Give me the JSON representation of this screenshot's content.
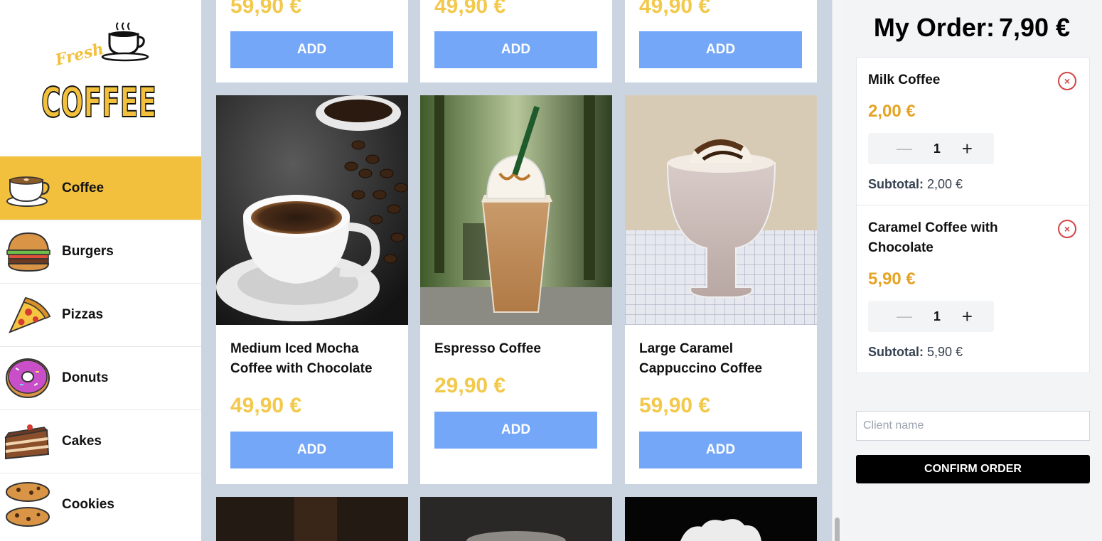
{
  "logo": {
    "top": "Fresh",
    "main": "COFFEE"
  },
  "categories": [
    {
      "label": "Coffee",
      "icon": "coffee-cup-icon",
      "active": true
    },
    {
      "label": "Burgers",
      "icon": "burger-icon"
    },
    {
      "label": "Pizzas",
      "icon": "pizza-slice-icon"
    },
    {
      "label": "Donuts",
      "icon": "donut-icon"
    },
    {
      "label": "Cakes",
      "icon": "cake-slice-icon"
    },
    {
      "label": "Cookies",
      "icon": "cookies-icon"
    }
  ],
  "products_top_row": [
    {
      "price": "59,90 €",
      "button": "ADD"
    },
    {
      "price": "49,90 €",
      "button": "ADD"
    },
    {
      "price": "49,90 €",
      "button": "ADD"
    }
  ],
  "products": [
    {
      "name": "Medium Iced Mocha Coffee with Chocolate",
      "price": "49,90 €",
      "button": "ADD",
      "image": "hot coffee cup with beans"
    },
    {
      "name": "Espresso Coffee",
      "price": "29,90 €",
      "button": "ADD",
      "image": "iced frappe with straw"
    },
    {
      "name": "Large Caramel Cappuccino Coffee",
      "price": "59,90 €",
      "button": "ADD",
      "image": "milkshake glass"
    }
  ],
  "order": {
    "title": "My Order:",
    "total": "7,90 €",
    "items": [
      {
        "name": "Milk Coffee",
        "price": "2,00 €",
        "qty": "1",
        "subtotal_label": "Subtotal:",
        "subtotal": "2,00 €",
        "minus": "—",
        "plus": "+",
        "remove": "×"
      },
      {
        "name": "Caramel Coffee with Chocolate",
        "price": "5,90 €",
        "qty": "1",
        "subtotal_label": "Subtotal:",
        "subtotal": "5,90 €",
        "minus": "—",
        "plus": "+",
        "remove": "×"
      }
    ],
    "client_placeholder": "Client name",
    "confirm_label": "CONFIRM ORDER"
  },
  "colors": {
    "accent": "#f2c03d",
    "add_button": "#74a7f7",
    "price_card": "#f2c94c",
    "price_order": "#e5a323",
    "remove": "#d04545"
  }
}
